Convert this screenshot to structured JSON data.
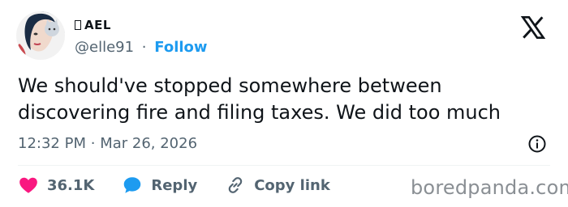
{
  "user": {
    "display_name": "AEL",
    "handle": "@elle91",
    "separator": "·",
    "follow_label": "Follow"
  },
  "tweet": {
    "text": "We should've stopped somewhere between discovering fire and filing taxes. We did too much",
    "time": "12:32 PM",
    "time_separator": "·",
    "date": "Mar 26, 2026"
  },
  "actions": {
    "likes": "36.1K",
    "reply_label": "Reply",
    "copy_link_label": "Copy link"
  },
  "watermark": "boredpanda.com",
  "colors": {
    "accent": "#1d9bf0",
    "like": "#f91880",
    "secondary_text": "#536471",
    "primary_text": "#0f1419"
  },
  "icons": [
    "x-logo-icon",
    "info-icon",
    "heart-icon",
    "reply-bubble-icon",
    "link-icon"
  ]
}
